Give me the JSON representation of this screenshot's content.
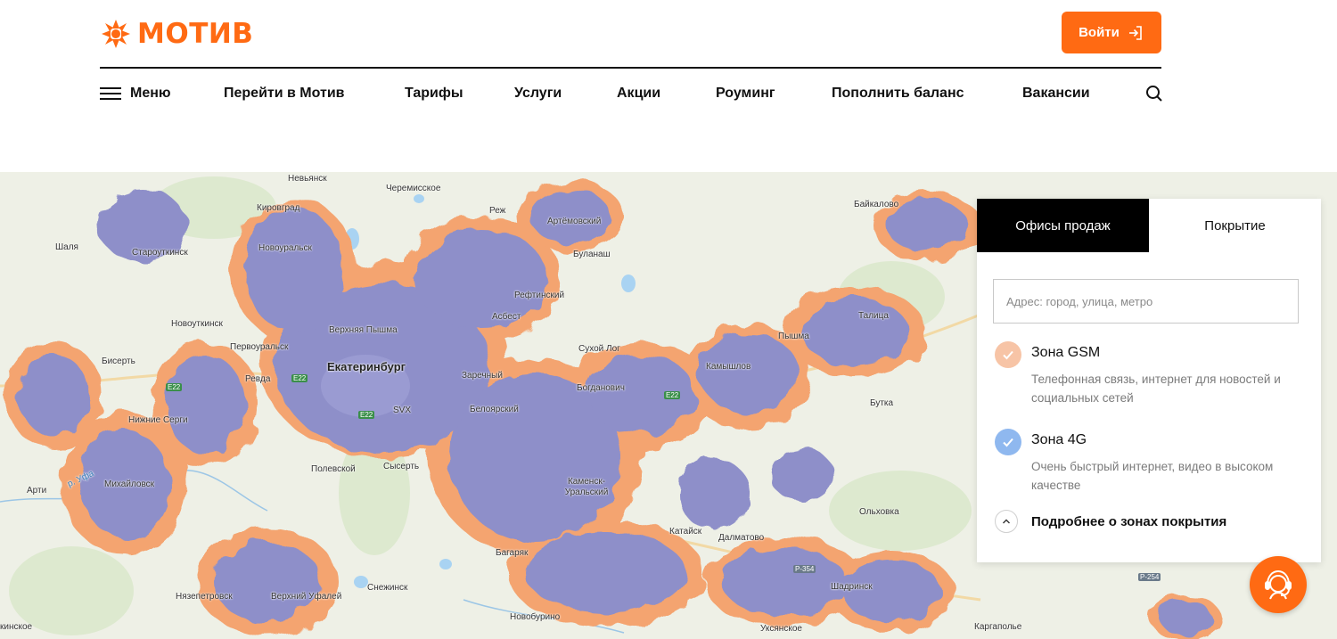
{
  "brand": {
    "name": "МОТИВ",
    "accent": "#ff6a13"
  },
  "header": {
    "login_label": "Войти",
    "nav": {
      "menu": "Меню",
      "go_motiv": "Перейти в Мотив",
      "tariffs": "Тарифы",
      "services": "Услуги",
      "promotions": "Акции",
      "roaming": "Роуминг",
      "topup": "Пополнить баланс",
      "vacancies": "Вакансии"
    }
  },
  "panel": {
    "tabs": {
      "offices": "Офисы продаж",
      "coverage": "Покрытие"
    },
    "active_tab": "Офисы продаж",
    "address_placeholder": "Адрес: город, улица, метро",
    "zones": [
      {
        "title": "Зона GSM",
        "desc": "Телефонная связь, интернет для новостей и социальных сетей",
        "color": "#f7c4a6"
      },
      {
        "title": "Зона 4G",
        "desc": "Очень быстрый интернет, видео в высоком качестве",
        "color": "#8fb8ef"
      }
    ],
    "more_label": "Подробнее о зонах покрытия"
  },
  "map": {
    "coverage_colors": {
      "gsm": "#f4a470",
      "lte": "#8e8fc9"
    },
    "cities": {
      "ekaterinburg": "Екатеринбург",
      "nevyansk": "Невьянск",
      "kirovgrad": "Кировград",
      "novouralsk": "Новоуральск",
      "cheremisskoe": "Черемисское",
      "rezh": "Реж",
      "artemovsky": "Артёмовский",
      "bulanash": "Буланаш",
      "baykalovo": "Байкалово",
      "shalya": "Шаля",
      "staroutkinsk": "Староуткинск",
      "reftinsky": "Рефтинский",
      "asbest": "Асбест",
      "verkhnyaya_pyshma": "Верхняя Пышма",
      "novoutkinsk": "Новоуткинск",
      "pervouralsk": "Первоуральск",
      "sukhoy_log": "Сухой Лог",
      "pyshma": "Пышма",
      "talitsa": "Талица",
      "biserti": "Бисерть",
      "revda": "Ревда",
      "kamyshlov": "Камышлов",
      "zarechny": "Заречный",
      "bogdanovich": "Богданович",
      "beloyarsky": "Белоярский",
      "nizhnie_sergi": "Нижние Серги",
      "butka": "Бутка",
      "polevskoy": "Полевской",
      "sysert": "Сысерть",
      "arti": "Арти",
      "mikhaylovsk": "Михайловск",
      "kamensk": "Каменск-Уральский",
      "olkhovka": "Ольховка",
      "kataysk": "Катайск",
      "dalmatovo": "Далматово",
      "bagaryak": "Багаряк",
      "snezhinsk": "Снежинск",
      "shadrinsk": "Шадринск",
      "nyazepetrovsk": "Нязепетровск",
      "verkhny_ufaley": "Верхний Уфалей",
      "novoburino": "Новобурино",
      "kargapolye": "Каргаполье",
      "uksyanskoe": "Уксянское",
      "kinskoe": "кинское"
    },
    "roads": {
      "e22a": "E22",
      "e22b": "E22",
      "e22c": "E22",
      "e22d": "E22",
      "r354": "Р-354",
      "r254": "Р-254",
      "svx": "SVX"
    },
    "river_ufa": "р. Уфа"
  }
}
